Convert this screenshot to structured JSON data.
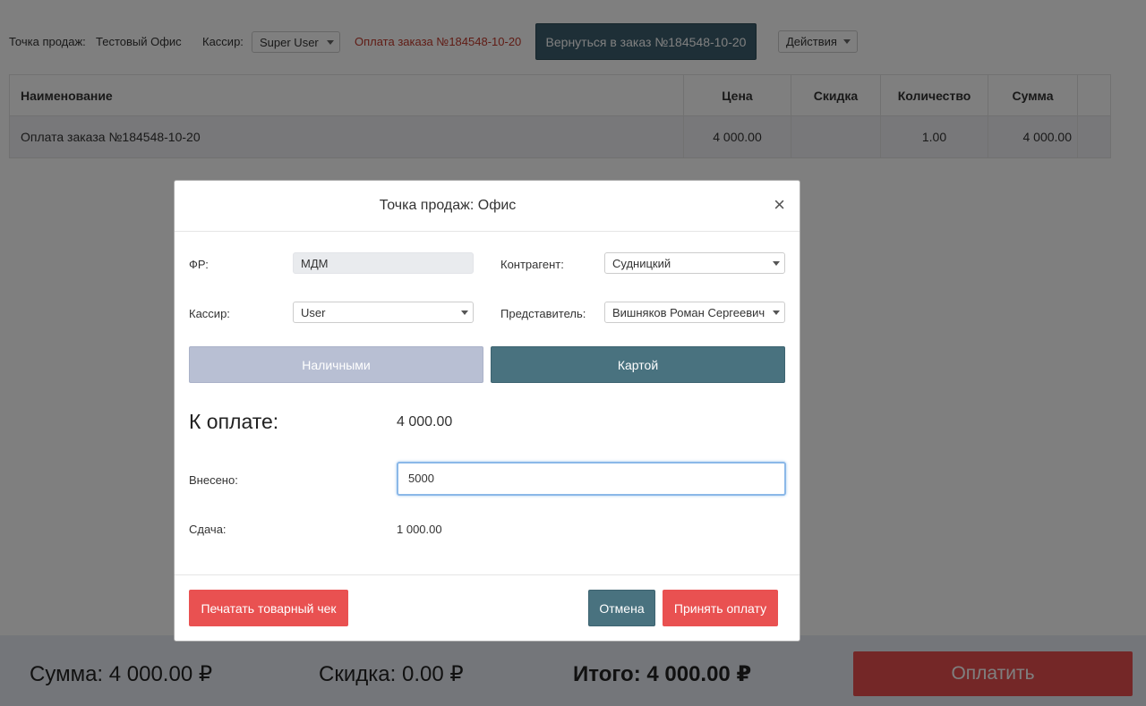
{
  "topbar": {
    "point_label": "Точка продаж:",
    "point_value": "Тестовый Офис",
    "cashier_label": "Кассир:",
    "cashier_value": "Super User",
    "order_link": "Оплата заказа №184548-10-20",
    "back_button": "Вернуться в заказ №184548-10-20",
    "actions_button": "Действия"
  },
  "table": {
    "headers": {
      "name": "Наименование",
      "price": "Цена",
      "discount": "Скидка",
      "qty": "Количество",
      "sum": "Сумма"
    },
    "rows": [
      {
        "name": "Оплата заказа №184548-10-20",
        "price": "4 000.00",
        "discount": "",
        "qty": "1.00",
        "sum": "4 000.00"
      }
    ]
  },
  "footer": {
    "sum_label": "Сумма:",
    "sum_value": "4 000.00 ₽",
    "discount_label": "Скидка:",
    "discount_value": "0.00 ₽",
    "total_label": "Итого:",
    "total_value": "4 000.00 ₽",
    "pay_button": "Оплатить"
  },
  "modal": {
    "title": "Точка продаж: Офис",
    "close_icon": "×",
    "fr_label": "ФР:",
    "fr_value": "МДМ",
    "contractor_label": "Контрагент:",
    "contractor_value": "Судницкий",
    "cashier_label": "Кассир:",
    "cashier_value": "User",
    "representative_label": "Представитель:",
    "representative_value": "Вишняков Роман Сергеевич",
    "tab_cash": "Наличными",
    "tab_card": "Картой",
    "to_pay_label": "К оплате:",
    "to_pay_value": "4 000.00",
    "paid_label": "Внесено:",
    "paid_value": "5000",
    "change_label": "Сдача:",
    "change_value": "1 000.00",
    "print_button": "Печатать товарный чек",
    "cancel_button": "Отмена",
    "accept_button": "Принять оплату"
  },
  "colors": {
    "accent_dark": "#49727f",
    "accent_red": "#e95151",
    "tab_inactive": "#b8bfd3"
  }
}
